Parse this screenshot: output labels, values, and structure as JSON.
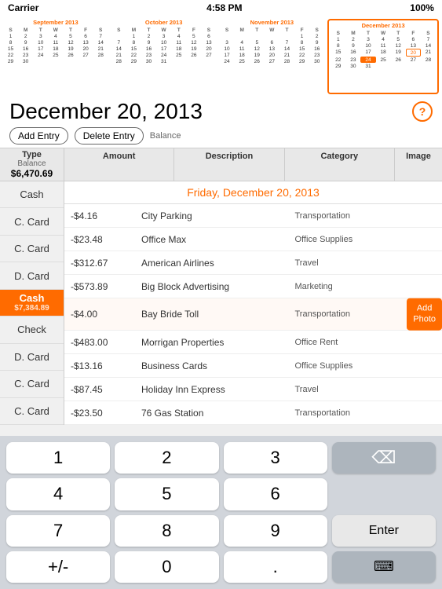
{
  "statusBar": {
    "carrier": "Carrier",
    "time": "4:58 PM",
    "battery": "100%"
  },
  "calendars": [
    {
      "month": "September 2013",
      "active": false,
      "days": [
        "S",
        "M",
        "T",
        "W",
        "T",
        "F",
        "S",
        "1",
        "2",
        "3",
        "4",
        "5",
        "6",
        "7",
        "8",
        "9",
        "10",
        "11",
        "12",
        "13",
        "14",
        "15",
        "16",
        "17",
        "18",
        "19",
        "20",
        "21",
        "22",
        "23",
        "24",
        "25",
        "26",
        "27",
        "28",
        "29",
        "30",
        "",
        "",
        "",
        "",
        "",
        ""
      ]
    },
    {
      "month": "October 2013",
      "active": false,
      "days": [
        "S",
        "M",
        "T",
        "W",
        "T",
        "F",
        "S",
        "",
        "1",
        "2",
        "3",
        "4",
        "5",
        "6",
        "7",
        "8",
        "9",
        "10",
        "11",
        "12",
        "13",
        "14",
        "15",
        "16",
        "17",
        "18",
        "19",
        "20",
        "21",
        "22",
        "23",
        "24",
        "25",
        "26",
        "27",
        "28",
        "29",
        "30",
        "31",
        "",
        "",
        ""
      ]
    },
    {
      "month": "November 2013",
      "active": false,
      "days": [
        "S",
        "M",
        "T",
        "W",
        "T",
        "F",
        "S",
        "",
        "",
        "",
        "",
        "",
        "1",
        "2",
        "3",
        "4",
        "5",
        "6",
        "7",
        "8",
        "9",
        "10",
        "11",
        "12",
        "13",
        "14",
        "15",
        "16",
        "17",
        "18",
        "19",
        "20",
        "21",
        "22",
        "23",
        "24",
        "25",
        "26",
        "27",
        "28",
        "29",
        "30"
      ]
    },
    {
      "month": "December 2013",
      "active": true,
      "days": [
        "S",
        "M",
        "T",
        "W",
        "T",
        "F",
        "S",
        "1",
        "2",
        "3",
        "4",
        "5",
        "6",
        "7",
        "8",
        "9",
        "10",
        "11",
        "12",
        "13",
        "14",
        "15",
        "16",
        "17",
        "18",
        "19",
        "20",
        "21",
        "22",
        "23",
        "24",
        "25",
        "26",
        "27",
        "28",
        "29",
        "30",
        "31"
      ]
    }
  ],
  "mainDate": "December 20, 2013",
  "buttons": {
    "addEntry": "Add Entry",
    "deleteEntry": "Delete Entry",
    "balance": "Balance"
  },
  "tableHeaders": {
    "type": "Type",
    "balance": "Balance",
    "balanceValue": "$6,470.69",
    "amount": "Amount",
    "description": "Description",
    "category": "Category",
    "image": "Image"
  },
  "dayLabel": "Friday, December 20, 2013",
  "rows": [
    {
      "type": "Cash",
      "balance": "",
      "amount": "-$4.16",
      "description": "City Parking",
      "category": "Transportation",
      "highlighted": false
    },
    {
      "type": "C. Card",
      "balance": "",
      "amount": "-$23.48",
      "description": "Office Max",
      "category": "Office Supplies",
      "highlighted": false
    },
    {
      "type": "C. Card",
      "balance": "",
      "amount": "-$312.67",
      "description": "American Airlines",
      "category": "Travel",
      "highlighted": false
    },
    {
      "type": "D. Card",
      "balance": "",
      "amount": "-$573.89",
      "description": "Big Block Advertising",
      "category": "Marketing",
      "highlighted": false
    },
    {
      "type": "Cash",
      "balance": "$7,384.89",
      "amount": "-$4.00",
      "description": "Bay Bride Toll",
      "category": "Transportation",
      "highlighted": true
    },
    {
      "type": "Check",
      "balance": "",
      "amount": "-$483.00",
      "description": "Morrigan Properties",
      "category": "Office Rent",
      "highlighted": false
    },
    {
      "type": "D. Card",
      "balance": "",
      "amount": "-$13.16",
      "description": "Business Cards",
      "category": "Office Supplies",
      "highlighted": false
    },
    {
      "type": "C. Card",
      "balance": "",
      "amount": "-$87.45",
      "description": "Holiday Inn Express",
      "category": "Travel",
      "highlighted": false
    },
    {
      "type": "C. Card",
      "balance": "",
      "amount": "-$23.50",
      "description": "76 Gas Station",
      "category": "Transportation",
      "highlighted": false
    }
  ],
  "addPhoto": "Add\nPhoto",
  "numpad": {
    "keys": [
      {
        "label": "1",
        "type": "num"
      },
      {
        "label": "2",
        "type": "num"
      },
      {
        "label": "3",
        "type": "num"
      },
      {
        "label": "⌫",
        "type": "gray"
      },
      {
        "label": "4",
        "type": "num"
      },
      {
        "label": "5",
        "type": "num"
      },
      {
        "label": "6",
        "type": "num"
      },
      {
        "label": "",
        "type": "empty"
      },
      {
        "label": "7",
        "type": "num"
      },
      {
        "label": "8",
        "type": "num"
      },
      {
        "label": "9",
        "type": "num"
      },
      {
        "label": "Enter",
        "type": "enter"
      },
      {
        "label": "+/-",
        "type": "num"
      },
      {
        "label": "0",
        "type": "num"
      },
      {
        "label": ".",
        "type": "num"
      },
      {
        "label": "⌨",
        "type": "keyboard"
      }
    ]
  }
}
